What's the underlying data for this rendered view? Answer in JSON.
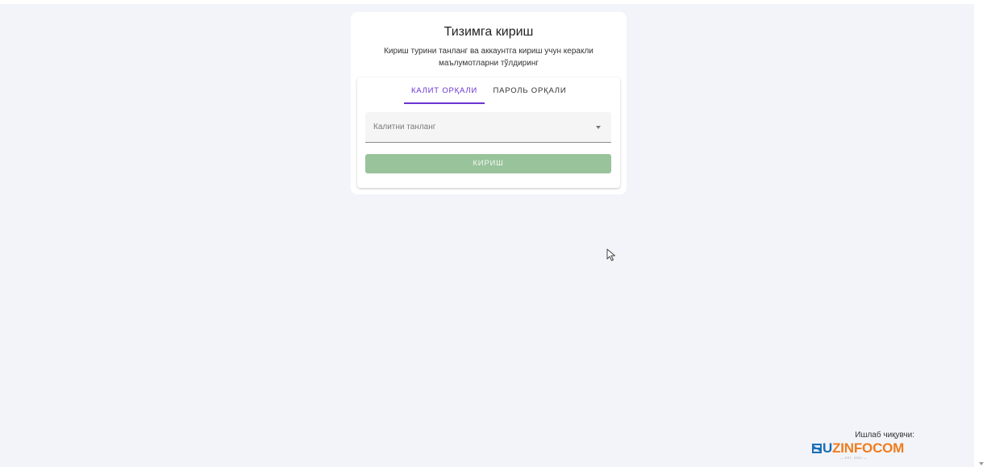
{
  "login": {
    "title": "Тизимга кириш",
    "subtitle": "Кириш турини танланг ва аккаунтга кириш учун керакли маълумотларни тўлдиринг",
    "tabs": [
      {
        "label": "КАЛИТ ОРҚАЛИ",
        "active": true
      },
      {
        "label": "ПАРОЛЬ ОРҚАЛИ",
        "active": false
      }
    ],
    "key_select": {
      "placeholder": "Калитни танланг",
      "value": ""
    },
    "submit_label": "КИРИШ"
  },
  "footer": {
    "made_by": "Ишлаб чиқувчи:",
    "logo_text": "UZINFOCOM",
    "logo_est": "— EST. 2002 —"
  },
  "colors": {
    "accent": "#6a34d1",
    "button": "#98c39b",
    "background": "#f2f4fa",
    "logo_blue": "#1d6fb4",
    "logo_orange": "#f07c1d"
  },
  "icons": [
    "chevron-down-icon",
    "mouse-pointer-icon",
    "uzinfocom-logo-icon"
  ]
}
